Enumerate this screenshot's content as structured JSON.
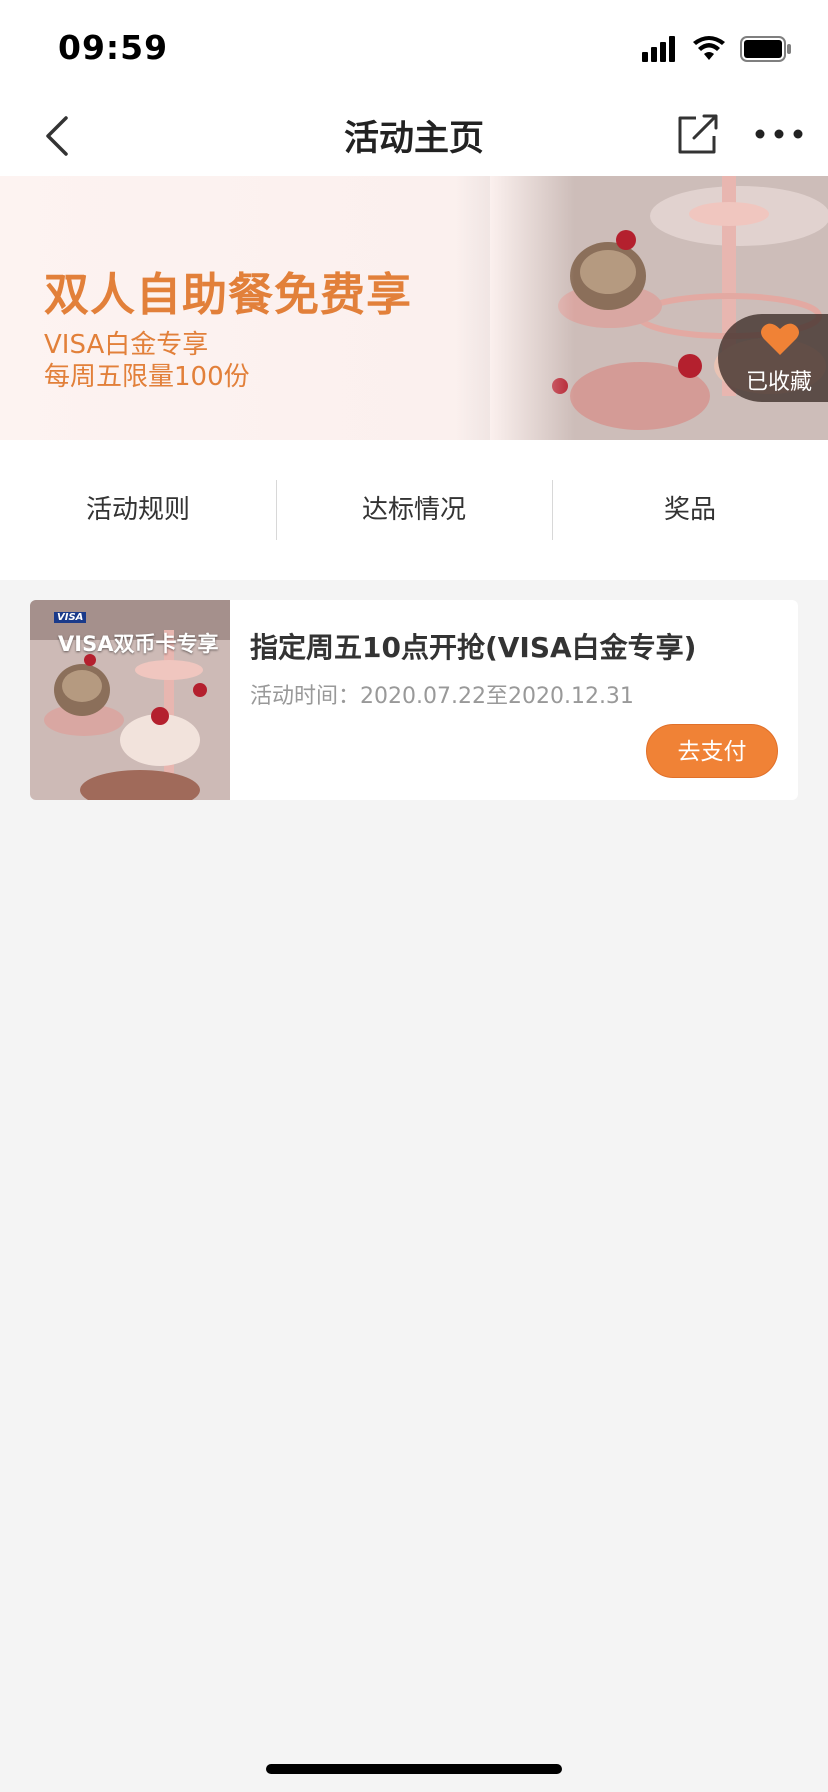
{
  "status_bar": {
    "time": "09:59",
    "icons": [
      "cellular-signal-icon",
      "wifi-icon",
      "battery-icon"
    ]
  },
  "navbar": {
    "title": "活动主页",
    "icons": [
      "chevron-left-icon",
      "share-icon",
      "more-icon"
    ]
  },
  "banner": {
    "title": "双人自助餐免费享",
    "subtitle_1": "VISA白金专享",
    "subtitle_2": "每周五限量100份",
    "favorite_label": "已收藏",
    "favorite_icon": "heart-icon"
  },
  "tabs": [
    {
      "label": "活动规则"
    },
    {
      "label": "达标情况"
    },
    {
      "label": "奖品"
    }
  ],
  "activity_card": {
    "thumb_label": "VISA双币卡专享",
    "thumb_logo": "VISA",
    "title": "指定周五10点开抢(VISA白金专享)",
    "time": "活动时间：2020.07.22至2020.12.31",
    "pay_label": "去支付"
  },
  "colors": {
    "accent": "#f08236",
    "banner_text": "#e2803a",
    "page_bg": "#f4f4f4"
  }
}
